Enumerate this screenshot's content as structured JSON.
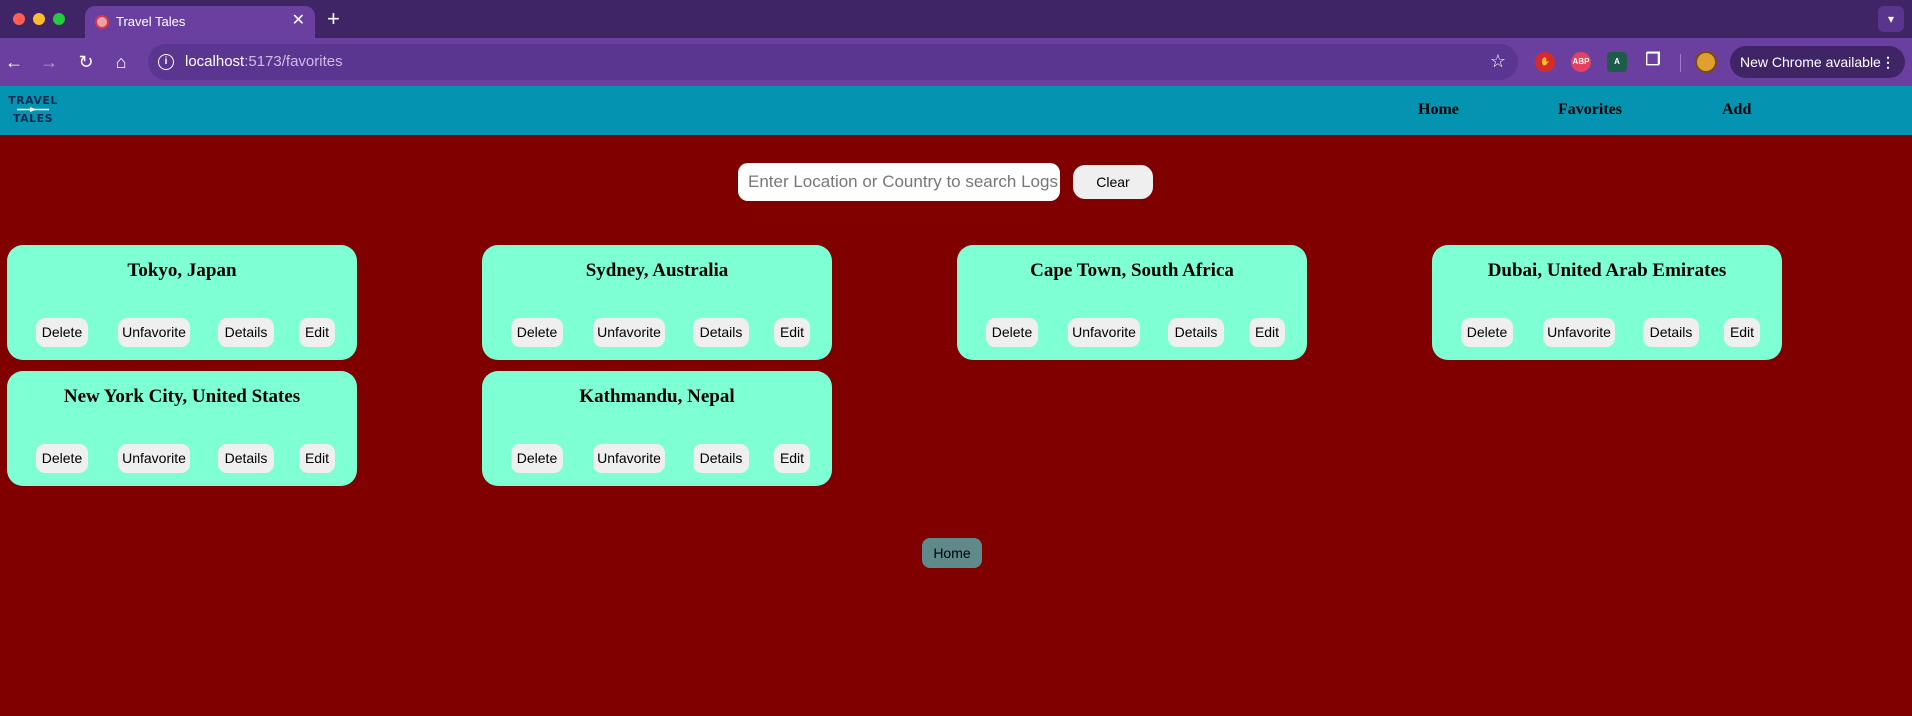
{
  "browser": {
    "tab_title": "Travel Tales",
    "tab_close": "✕",
    "new_tab": "+",
    "url_host": "localhost",
    "url_path": ":5173/favorites",
    "update_label": "New Chrome available",
    "update_menu": "⋮",
    "ext_abp": "ABP",
    "ext_a": "A"
  },
  "logo": {
    "line1": "TRAVEL",
    "line2": "TALES"
  },
  "nav": {
    "home": "Home",
    "favorites": "Favorites",
    "add": "Add"
  },
  "search": {
    "placeholder": "Enter Location or Country to search Logs",
    "clear_label": "Clear"
  },
  "card_buttons": {
    "delete": "Delete",
    "unfavorite": "Unfavorite",
    "details": "Details",
    "edit": "Edit"
  },
  "cards": [
    {
      "title": "Tokyo, Japan"
    },
    {
      "title": "Sydney, Australia"
    },
    {
      "title": "Cape Town, South Africa"
    },
    {
      "title": "Dubai, United Arab Emirates"
    },
    {
      "title": "New York City, United States"
    },
    {
      "title": "Kathmandu, Nepal"
    }
  ],
  "footer": {
    "home_label": "Home"
  },
  "colors": {
    "page_bg": "#800000",
    "navbar_bg": "#0494b2",
    "card_bg": "#7fffd4",
    "home_button_bg": "#5f8a8b",
    "browser_purple": "#6a3fa0"
  }
}
